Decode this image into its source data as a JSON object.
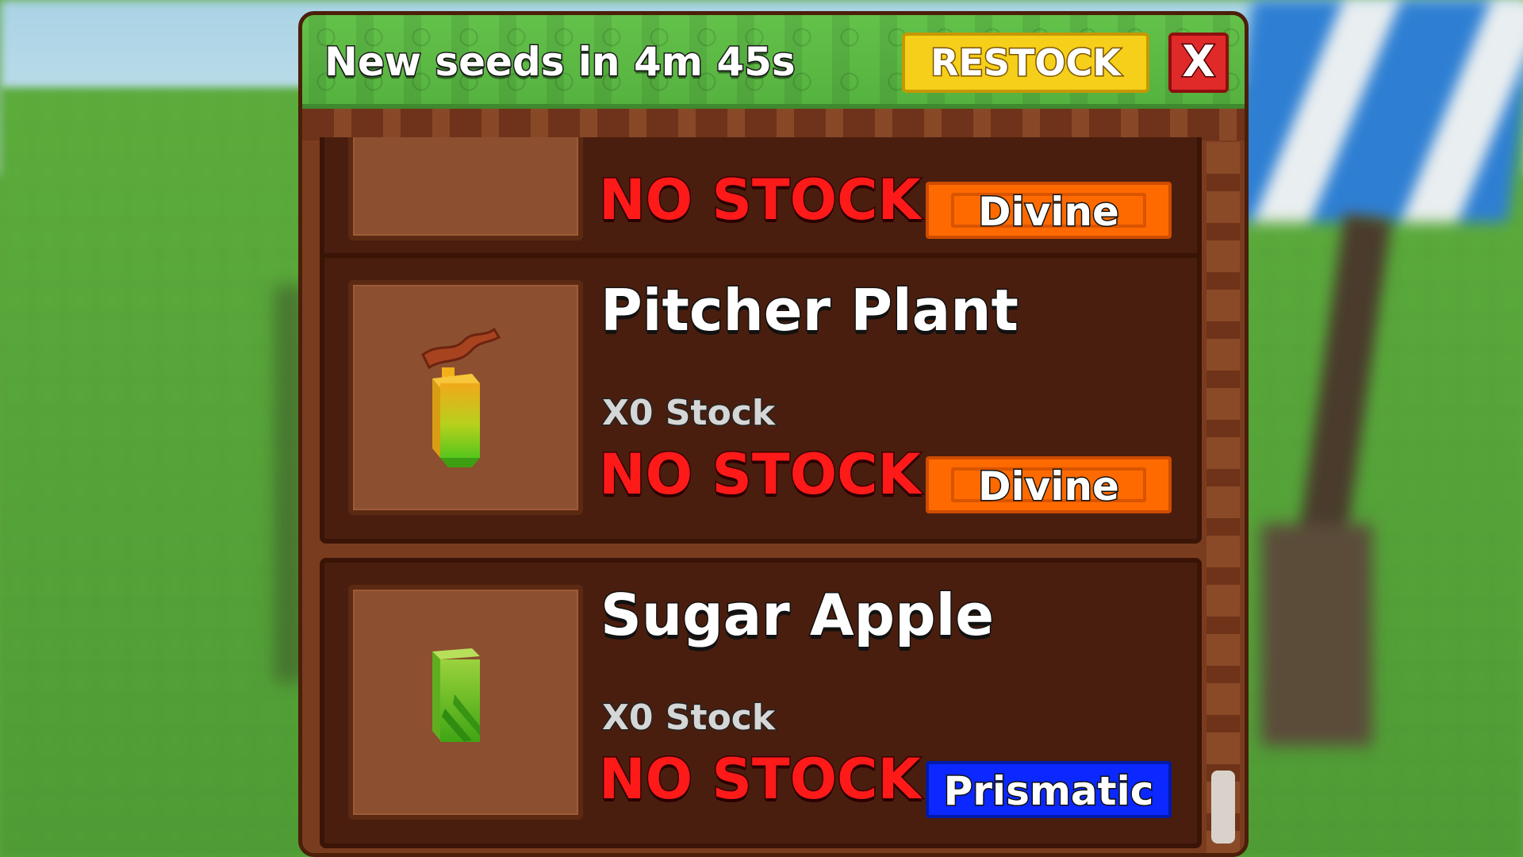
{
  "header": {
    "timer_text": "New seeds in 4m 45s",
    "restock_label": "RESTOCK",
    "close_label": "X"
  },
  "items": [
    {
      "name": "",
      "stock_text": "",
      "status_text": "NO STOCK",
      "rarity": "Divine",
      "icon": "seed-pack-icon"
    },
    {
      "name": "Pitcher Plant",
      "stock_text": "X0 Stock",
      "status_text": "NO STOCK",
      "rarity": "Divine",
      "icon": "pitcher-plant-seed-icon"
    },
    {
      "name": "Sugar Apple",
      "stock_text": "X0 Stock",
      "status_text": "NO STOCK",
      "rarity": "Prismatic",
      "icon": "sugar-apple-seed-icon"
    }
  ],
  "colors": {
    "header_green": "#5fb845",
    "panel_brown": "#7a3c1f",
    "divine_orange": "#ff6a00",
    "prismatic_blue": "#0a28ff",
    "no_stock_red": "#ff1a1a",
    "restock_yellow": "#f5cf19",
    "close_red": "#e02a2a"
  }
}
